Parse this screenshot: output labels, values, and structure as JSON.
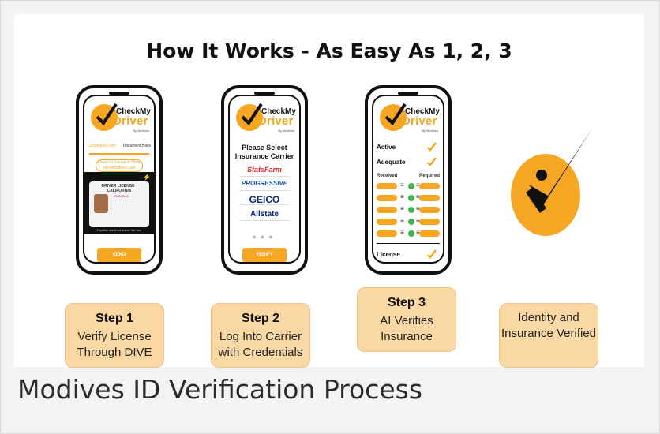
{
  "page": {
    "headline": "How It Works - As Easy As 1, 2, 3",
    "caption": "Modives ID Verification Process"
  },
  "brand": {
    "line1": "CheckMy",
    "line2": "Driver",
    "line3": "By Modives"
  },
  "phone1": {
    "tab_front": "Document Front",
    "tab_back": "Document Back",
    "pill_text": "Driver's License or State Identification Card",
    "license_title": "DRIVER LICENSE",
    "license_state": "CALIFORNIA",
    "license_text": "JOHN DOE",
    "hint": "Position the front inside the box",
    "button": "SEND"
  },
  "phone2": {
    "title": "Please Select Insurance Carrier",
    "carriers": [
      "StateFarm",
      "PROGRESSIVE",
      "GEICO",
      "Allstate"
    ],
    "button": "VERIFY"
  },
  "phone3": {
    "active": "Active",
    "adequate": "Adequate",
    "received": "Received",
    "required": "Required",
    "license": "License"
  },
  "steps": [
    {
      "title": "Step 1",
      "desc": "Verify License Through DIVE"
    },
    {
      "title": "Step 2",
      "desc": "Log Into Carrier with Credentials"
    },
    {
      "title": "Step 3",
      "desc": "AI Verifies Insurance"
    },
    {
      "title": "",
      "desc": "Identity and Insurance Verified"
    }
  ],
  "colors": {
    "accent": "#f5a623",
    "step_bg": "#f9d8a4",
    "check_green": "#3cb24a"
  }
}
